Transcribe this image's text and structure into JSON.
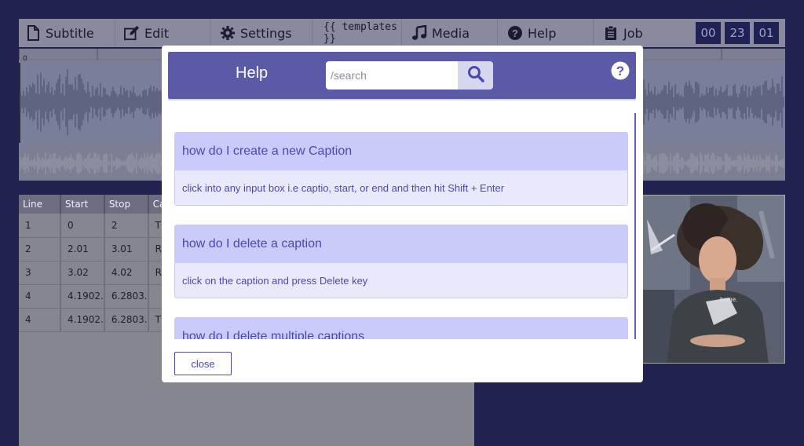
{
  "toolbar": {
    "items": [
      {
        "label": "Subtitle",
        "icon": "file-icon"
      },
      {
        "label": "Edit",
        "icon": "edit-icon"
      },
      {
        "label": "Settings",
        "icon": "gear-icon"
      },
      {
        "label": "{{ templates }}",
        "icon": ""
      },
      {
        "label": "Media",
        "icon": "music-icon"
      },
      {
        "label": "Help",
        "icon": "question-circle-icon"
      },
      {
        "label": "Job",
        "icon": "clipboard-icon"
      }
    ],
    "timer": [
      "00",
      "23",
      "01"
    ]
  },
  "waveform": {
    "ruler_start": "0"
  },
  "table": {
    "headers": [
      "Line",
      "Start",
      "Stop",
      "Cap"
    ],
    "rows": [
      [
        "1",
        "0",
        "2",
        "Thi"
      ],
      [
        "2",
        "2.01",
        "3.01",
        "Rig"
      ],
      [
        "3",
        "3.02",
        "4.02",
        "Rig"
      ],
      [
        "4",
        "4.1902.",
        "6.2803.",
        ""
      ],
      [
        "4",
        "4.1902.",
        "6.2803.",
        "Thi"
      ]
    ]
  },
  "video": {
    "shirt_text": "home."
  },
  "modal": {
    "title": "Help",
    "search_placeholder": "/search",
    "faqs": [
      {
        "q": "how do I create a new Caption",
        "a": "click into any input box i.e captio, start, or end and then hit Shift + Enter"
      },
      {
        "q": "how do I delete a caption",
        "a": "click on the caption and press Delete key"
      },
      {
        "q": "how do I delete multiple captions",
        "a": ""
      }
    ],
    "close_label": "close"
  },
  "colors": {
    "background": "#222250",
    "modal_header": "#5b5aa6",
    "faq_question_bg": "#cbcbfb",
    "faq_answer_bg": "#e9e9fd",
    "accent_text": "#4a49b0"
  }
}
